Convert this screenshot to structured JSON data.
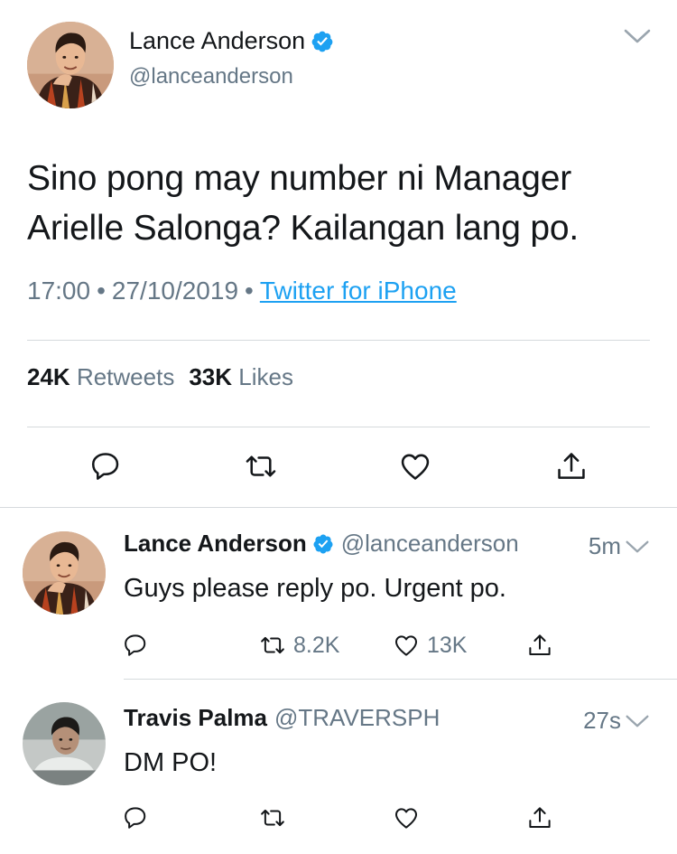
{
  "main_tweet": {
    "author_name": "Lance Anderson",
    "author_handle": "@lanceanderson",
    "text": "Sino pong may number ni Manager Arielle Salonga? Kailangan lang po.",
    "time": "17:00",
    "date": "27/10/2019",
    "source": "Twitter for iPhone",
    "retweets_count": "24K",
    "retweets_label": "Retweets",
    "likes_count": "33K",
    "likes_label": "Likes"
  },
  "replies": [
    {
      "author_name": "Lance Anderson",
      "author_handle": "@lanceanderson",
      "verified": true,
      "time": "5m",
      "text": "Guys please reply po. Urgent po.",
      "retweets": "8.2K",
      "likes": "13K"
    },
    {
      "author_name": "Travis Palma",
      "author_handle": "@TRAVERSPH",
      "verified": false,
      "time": "27s",
      "text": "DM PO!",
      "retweets": "",
      "likes": ""
    }
  ],
  "icons": {
    "reply": "reply-icon",
    "retweet": "retweet-icon",
    "like": "heart-icon",
    "share": "share-icon",
    "verified": "verified-badge-icon",
    "more": "chevron-down-icon"
  },
  "colors": {
    "link": "#1da1f2",
    "secondary_text": "#657786",
    "primary_text": "#14171a",
    "divider": "#d6dadd"
  }
}
